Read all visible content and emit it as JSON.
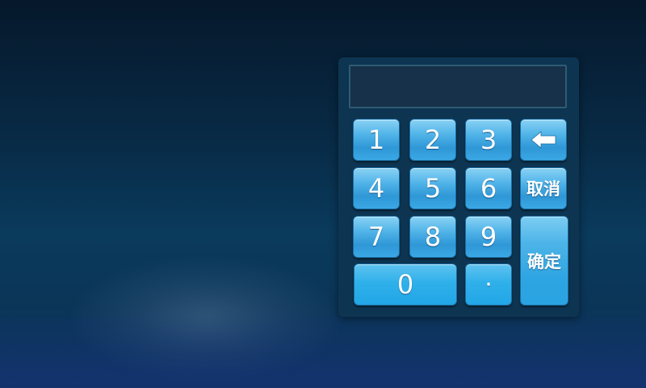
{
  "display": {
    "value": ""
  },
  "keys": {
    "k1": "1",
    "k2": "2",
    "k3": "3",
    "k4": "4",
    "k5": "5",
    "k6": "6",
    "k7": "7",
    "k8": "8",
    "k9": "9",
    "k0": "0",
    "dot": "·",
    "cancel": "取消",
    "confirm": "确定",
    "backspace_icon": "backspace-arrow-icon"
  },
  "colors": {
    "key_top": "#8ad2f4",
    "key_bottom": "#2f97d6",
    "panel": "#0d3552",
    "display_bg": "#163149"
  }
}
